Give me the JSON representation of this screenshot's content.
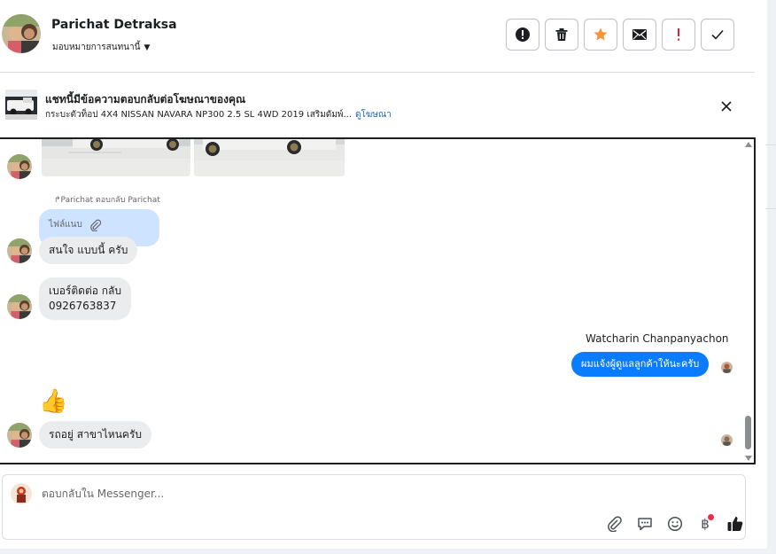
{
  "header": {
    "contact_name": "Parichat Detraksa",
    "assign_label": "มอบหมายการสนทนานี้",
    "actions": [
      {
        "name": "mark-spam-button",
        "icon": "alert-circle-icon"
      },
      {
        "name": "delete-button",
        "icon": "trash-icon"
      },
      {
        "name": "star-button",
        "icon": "star-icon"
      },
      {
        "name": "mark-unread-button",
        "icon": "envelope-icon"
      },
      {
        "name": "follow-up-button",
        "icon": "exclamation-icon"
      },
      {
        "name": "mark-done-button",
        "icon": "check-icon"
      }
    ]
  },
  "ad_banner": {
    "title": "แชทนี้มีข้อความตอบกลับต่อโฆษณาของคุณ",
    "subtitle": "กระบะตัวท็อป 4X4 NISSAN NAVARA NP300 2.5 SL 4WD 2019 เสริมดัมพ์...",
    "link": "ดูโฆษณา"
  },
  "thread": {
    "reply_note": "Parichat ตอบกลับ Parichat",
    "file_label": "ไฟล์แนบ",
    "messages": [
      {
        "from": "contact",
        "text": "สนใจ แบบนี้ ครับ"
      },
      {
        "from": "contact",
        "text_line1": "เบอร์ติดต่อ กลับ",
        "text_line2": "0926763837"
      },
      {
        "from": "page",
        "sender": "Watcharin Chanpanyachon",
        "text": "ผมแจ้งผู้ดูแลลูกค้าให้นะครับ"
      },
      {
        "from": "contact",
        "emoji": "👍"
      },
      {
        "from": "contact",
        "text": "รถอยู่ สาขาไหนครับ"
      }
    ]
  },
  "composer": {
    "placeholder": "ตอบกลับใน Messenger...",
    "tools": [
      "attachment-icon",
      "saved-reply-icon",
      "emoji-icon",
      "baht-payment-icon",
      "like-icon"
    ]
  },
  "colors": {
    "accent_blue": "#0a7cff",
    "star_orange": "#f7923a",
    "alert_red": "#e41e3f",
    "file_bubble": "#cde3ff"
  }
}
